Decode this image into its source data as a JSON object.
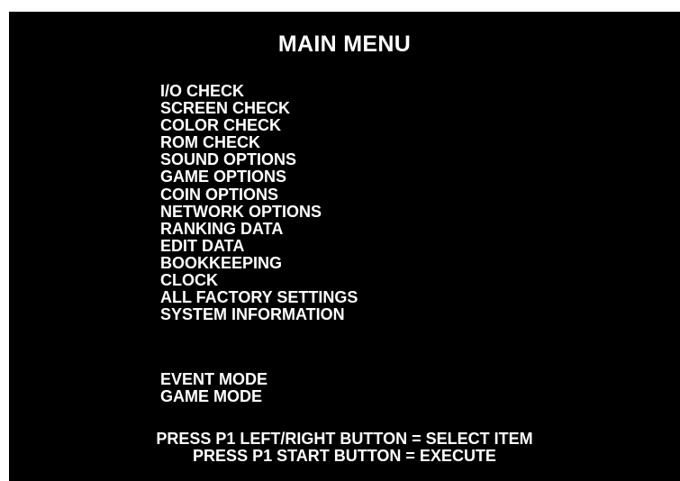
{
  "title": "MAIN MENU",
  "menu_items": [
    "I/O CHECK",
    "SCREEN CHECK",
    "COLOR CHECK",
    "ROM CHECK",
    "SOUND OPTIONS",
    "GAME OPTIONS",
    "COIN OPTIONS",
    "NETWORK OPTIONS",
    "RANKING DATA",
    "EDIT DATA",
    "BOOKKEEPING",
    "CLOCK",
    "ALL FACTORY SETTINGS",
    "SYSTEM INFORMATION"
  ],
  "mode_items": [
    "EVENT MODE",
    "GAME MODE"
  ],
  "instructions": {
    "select": "PRESS P1 LEFT/RIGHT BUTTON = SELECT ITEM",
    "execute": "PRESS P1 START BUTTON = EXECUTE"
  },
  "colors": {
    "background": "#000000",
    "text": "#ffffff"
  }
}
